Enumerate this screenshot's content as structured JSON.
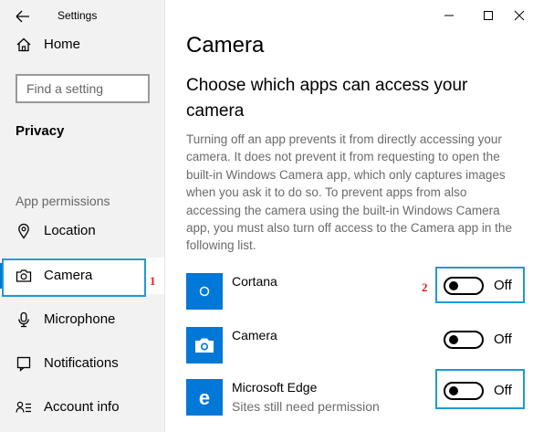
{
  "window": {
    "app_title": "Settings",
    "controls": {
      "minimize": "minimize",
      "maximize": "maximize",
      "close": "close"
    }
  },
  "sidebar": {
    "home_label": "Home",
    "search_placeholder": "Find a setting",
    "section_title": "Privacy",
    "group_title": "App permissions",
    "items": [
      {
        "label": "Location",
        "icon": "location-icon"
      },
      {
        "label": "Camera",
        "icon": "camera-icon",
        "selected": true
      },
      {
        "label": "Microphone",
        "icon": "microphone-icon"
      },
      {
        "label": "Notifications",
        "icon": "notifications-icon"
      },
      {
        "label": "Account info",
        "icon": "account-info-icon"
      }
    ]
  },
  "main": {
    "title": "Camera",
    "subheading": "Choose which apps can access your camera",
    "description": "Turning off an app prevents it from directly accessing your camera. It does not prevent it from requesting to open the built-in Windows Camera app, which only captures images when you ask it to do so. To prevent apps from also accessing the camera using the built-in Windows Camera app, you must also turn off access to the Camera app in the following list.",
    "apps": [
      {
        "name": "Cortana",
        "subtitle": "",
        "state": "Off"
      },
      {
        "name": "Camera",
        "subtitle": "",
        "state": "Off"
      },
      {
        "name": "Microsoft Edge",
        "subtitle": "Sites still need permission",
        "state": "Off"
      }
    ]
  },
  "annotations": {
    "marker_1": "1",
    "marker_2": "2",
    "highlight_color": "#1e9ad6",
    "marker_color": "#e0201f"
  },
  "colors": {
    "accent": "#0078d7",
    "sidebar_bg": "#f2f2f2"
  }
}
